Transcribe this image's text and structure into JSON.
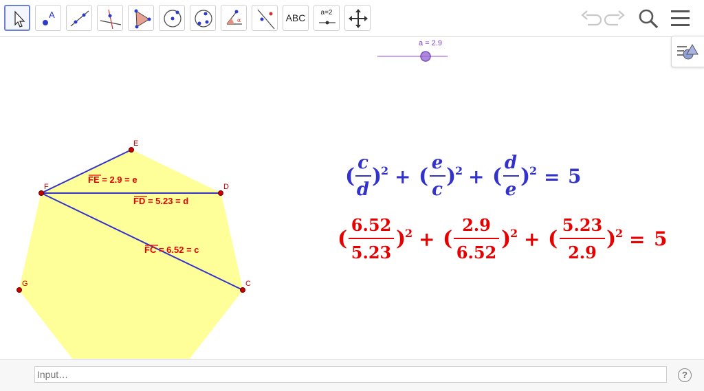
{
  "toolbar": {
    "tools": [
      {
        "name": "move-tool-icon"
      },
      {
        "name": "point-tool-icon"
      },
      {
        "name": "line-tool-icon"
      },
      {
        "name": "perpendicular-line-tool-icon"
      },
      {
        "name": "polygon-tool-icon"
      },
      {
        "name": "circle-tool-icon"
      },
      {
        "name": "conic-tool-icon"
      },
      {
        "name": "angle-tool-icon"
      },
      {
        "name": "reflect-tool-icon"
      },
      {
        "name": "text-tool-icon"
      },
      {
        "name": "slider-tool-icon"
      },
      {
        "name": "move-graphics-view-icon"
      }
    ],
    "text_tool_label": "ABC",
    "slider_tool_label": "a=2",
    "undo_icon": "undo-icon",
    "redo_icon": "redo-icon",
    "search_icon": "search-icon",
    "menu_icon": "hamburger-menu-icon"
  },
  "slider": {
    "label": "a = 2.9",
    "min": 0,
    "max": 5,
    "value": 2.9
  },
  "style_bar_icon": "style-bar-toggle-icon",
  "points": {
    "E": "E",
    "F": "F",
    "D": "D",
    "G": "G",
    "C": "C"
  },
  "labels": {
    "fe": "FE",
    "fe_rest": " = 2.9 = e",
    "fd": "FD",
    "fd_rest": " = 5.23 = d",
    "fc": "FC",
    "fc_rest": " = 6.52 = c"
  },
  "equation_symbolic": {
    "t1_num": "c",
    "t1_den": "d",
    "t2_num": "e",
    "t2_den": "c",
    "t3_num": "d",
    "t3_den": "e",
    "exp": "2",
    "result": "5"
  },
  "equation_numeric": {
    "t1_num": "6.52",
    "t1_den": "5.23",
    "t2_num": "2.9",
    "t2_den": "6.52",
    "t3_num": "5.23",
    "t3_den": "2.9",
    "exp": "2",
    "result": "5"
  },
  "input_bar": {
    "placeholder": "Input…",
    "help": "?"
  },
  "colors": {
    "polygon_fill": "#ffff99",
    "segment": "#3333cc",
    "label_red": "#e60000",
    "slider": "#7d3ec9"
  }
}
